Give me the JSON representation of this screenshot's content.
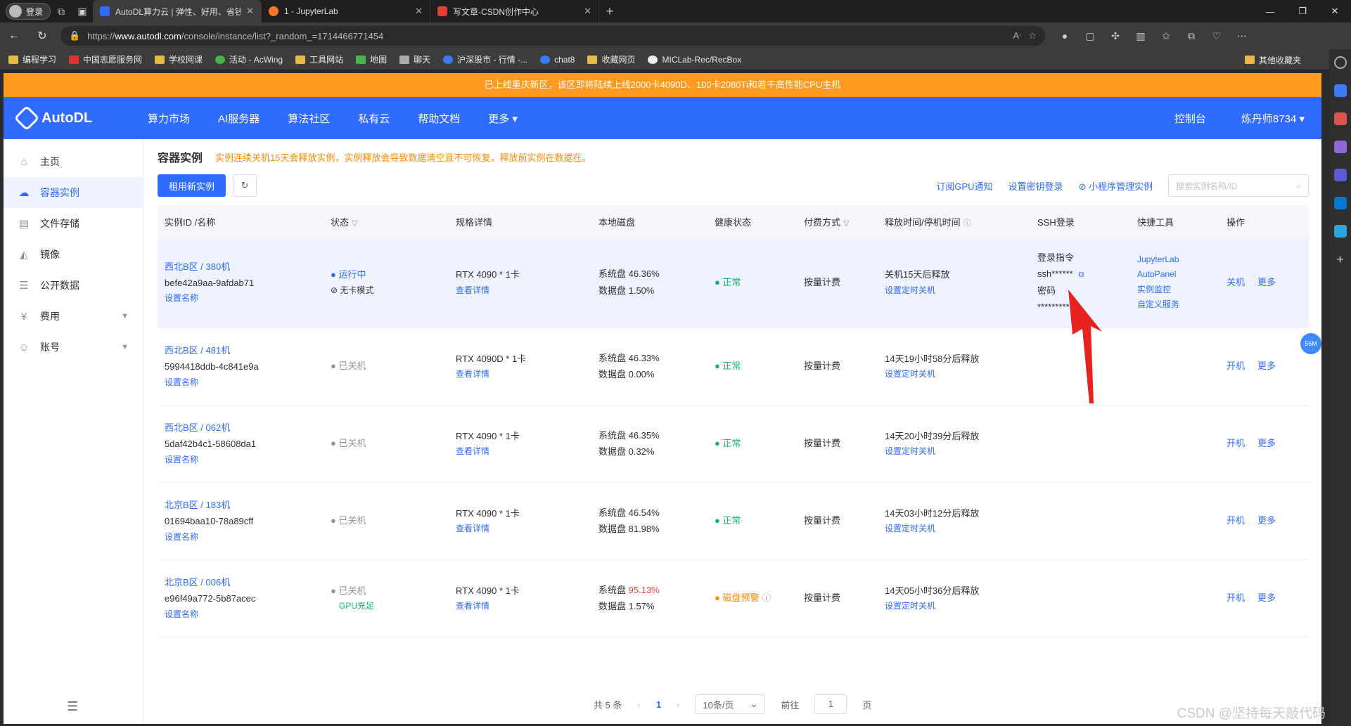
{
  "browser": {
    "login": "登录",
    "tabs": [
      {
        "title": "AutoDL算力云 | 弹性、好用、省钱",
        "color": "#2f6bff"
      },
      {
        "title": "1 - JupyterLab",
        "color": "#f37726"
      },
      {
        "title": "写文章-CSDN创作中心",
        "color": "#e33e33"
      }
    ],
    "url_prefix": "https://",
    "url_host": "www.autodl.com",
    "url_path": "/console/instance/list?_random_=1714466771454",
    "bookmarks": [
      "编程学习",
      "中国志愿服务网",
      "学校网课",
      "活动 - AcWing",
      "工具网站",
      "地图",
      "聊天",
      "沪深股市 - 行情 -...",
      "chat8",
      "收藏网页",
      "MICLab-Rec/RecBox"
    ],
    "other_bookmarks": "其他收藏夹"
  },
  "notice": "已上线重庆新区，该区即将陆续上线2000卡4090D、100卡2080Ti和若干高性能CPU主机",
  "topnav": {
    "brand": "AutoDL",
    "items": [
      "算力市场",
      "AI服务器",
      "算法社区",
      "私有云",
      "帮助文档",
      "更多 ▾"
    ],
    "console": "控制台",
    "user": "炼丹师8734 ▾"
  },
  "sidebar": {
    "items": [
      {
        "label": "主页",
        "icon": "home-icon"
      },
      {
        "label": "容器实例",
        "icon": "container-icon"
      },
      {
        "label": "文件存储",
        "icon": "storage-icon"
      },
      {
        "label": "镜像",
        "icon": "image-icon"
      },
      {
        "label": "公开数据",
        "icon": "database-icon"
      },
      {
        "label": "费用",
        "icon": "yen-icon"
      },
      {
        "label": "账号",
        "icon": "user-icon"
      }
    ]
  },
  "main": {
    "title": "容器实例",
    "warning": "实例连续关机15天会释放实例，实例释放会导致数据清空且不可恢复，释放前实例在数据在。",
    "rent_button": "租用新实例",
    "links": [
      "订阅GPU通知",
      "设置密钥登录",
      "小程序管理实例"
    ],
    "search_placeholder": "搜索实例名称/ID"
  },
  "table": {
    "headers": [
      "实例ID /名称",
      "状态",
      "规格详情",
      "本地磁盘",
      "健康状态",
      "付费方式",
      "释放时间/停机时间",
      "SSH登录",
      "快捷工具",
      "操作"
    ],
    "rows": [
      {
        "region": "西北B区 / 380机",
        "id": "befe42a9aa-9afdab71",
        "setname": "设置名称",
        "status": "运行中",
        "status2": "无卡模式",
        "spec": "RTX 4090 * 1卡",
        "detail": "查看详情",
        "sys": "系统盘 46.36%",
        "data": "数据盘 1.50%",
        "health": "正常",
        "pay": "按量计费",
        "release": "关机15天后释放",
        "timer": "设置定时关机",
        "ssh_label": "登录指令",
        "ssh_cmd": "ssh******",
        "pwd_label": "密码",
        "pwd": "*********",
        "tools": [
          "JupyterLab",
          "AutoPanel",
          "实例监控",
          "自定义服务"
        ],
        "op1": "关机",
        "op2": "更多"
      },
      {
        "region": "西北B区 / 481机",
        "id": "5994418ddb-4c841e9a",
        "setname": "设置名称",
        "status": "已关机",
        "spec": "RTX 4090D * 1卡",
        "detail": "查看详情",
        "sys": "系统盘 46.33%",
        "data": "数据盘 0.00%",
        "health": "正常",
        "pay": "按量计费",
        "release": "14天19小时58分后释放",
        "timer": "设置定时关机",
        "op1": "开机",
        "op2": "更多"
      },
      {
        "region": "西北B区 / 062机",
        "id": "5daf42b4c1-58608da1",
        "setname": "设置名称",
        "status": "已关机",
        "spec": "RTX 4090 * 1卡",
        "detail": "查看详情",
        "sys": "系统盘 46.35%",
        "data": "数据盘 0.32%",
        "health": "正常",
        "pay": "按量计费",
        "release": "14天20小时39分后释放",
        "timer": "设置定时关机",
        "op1": "开机",
        "op2": "更多"
      },
      {
        "region": "北京B区 / 183机",
        "id": "01694baa10-78a89cff",
        "setname": "设置名称",
        "status": "已关机",
        "spec": "RTX 4090 * 1卡",
        "detail": "查看详情",
        "sys": "系统盘 46.54%",
        "data": "数据盘 81.98%",
        "health": "正常",
        "pay": "按量计费",
        "release": "14天03小时12分后释放",
        "timer": "设置定时关机",
        "op1": "开机",
        "op2": "更多"
      },
      {
        "region": "北京B区 / 006机",
        "id": "e96f49a772-5b87acec",
        "setname": "设置名称",
        "status": "已关机",
        "status2": "GPU充足",
        "spec": "RTX 4090 * 1卡",
        "detail": "查看详情",
        "sys_label": "系统盘",
        "sys_val": "95.13%",
        "data": "数据盘 1.57%",
        "health": "磁盘预警",
        "pay": "按量计费",
        "release": "14天05小时36分后释放",
        "timer": "设置定时关机",
        "op1": "开机",
        "op2": "更多"
      }
    ]
  },
  "pager": {
    "total": "共 5 条",
    "page": "1",
    "size": "10条/页",
    "goto": "前往",
    "input": "1",
    "unit": "页"
  },
  "float_badge": "56M",
  "watermark": "CSDN @坚持每天敲代码",
  "colors": {
    "primary": "#2f6bff",
    "notice": "#ff9a1f",
    "ok": "#17b26a",
    "warn": "#ff8a00",
    "danger": "#f04438"
  }
}
